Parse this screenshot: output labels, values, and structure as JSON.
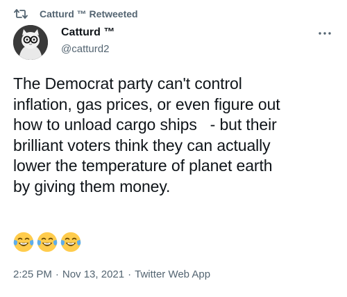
{
  "retweet": {
    "text": "Catturd ™ Retweeted",
    "icon": "retweet-icon"
  },
  "author": {
    "name": "Catturd ™",
    "handle": "@catturd2",
    "avatar": "avatar-cat-with-glasses"
  },
  "more_icon": "more-options-icon",
  "tweet": {
    "text": "The Democrat party can't control\ninflation, gas prices, or even figure out\nhow to unload cargo ships   - but their\nbrilliant voters think they can actually\nlower the temperature of planet earth\nby giving them money.",
    "emojis": [
      "face-with-tears-of-joy",
      "face-with-tears-of-joy",
      "face-with-tears-of-joy"
    ]
  },
  "meta": {
    "time": "2:25 PM",
    "separator": "·",
    "date": "Nov 13, 2021",
    "source": "Twitter Web App"
  },
  "colors": {
    "text_primary": "#0f1419",
    "text_secondary": "#536471",
    "emoji_face": "#ffcc4d",
    "emoji_tears": "#5dadec"
  }
}
